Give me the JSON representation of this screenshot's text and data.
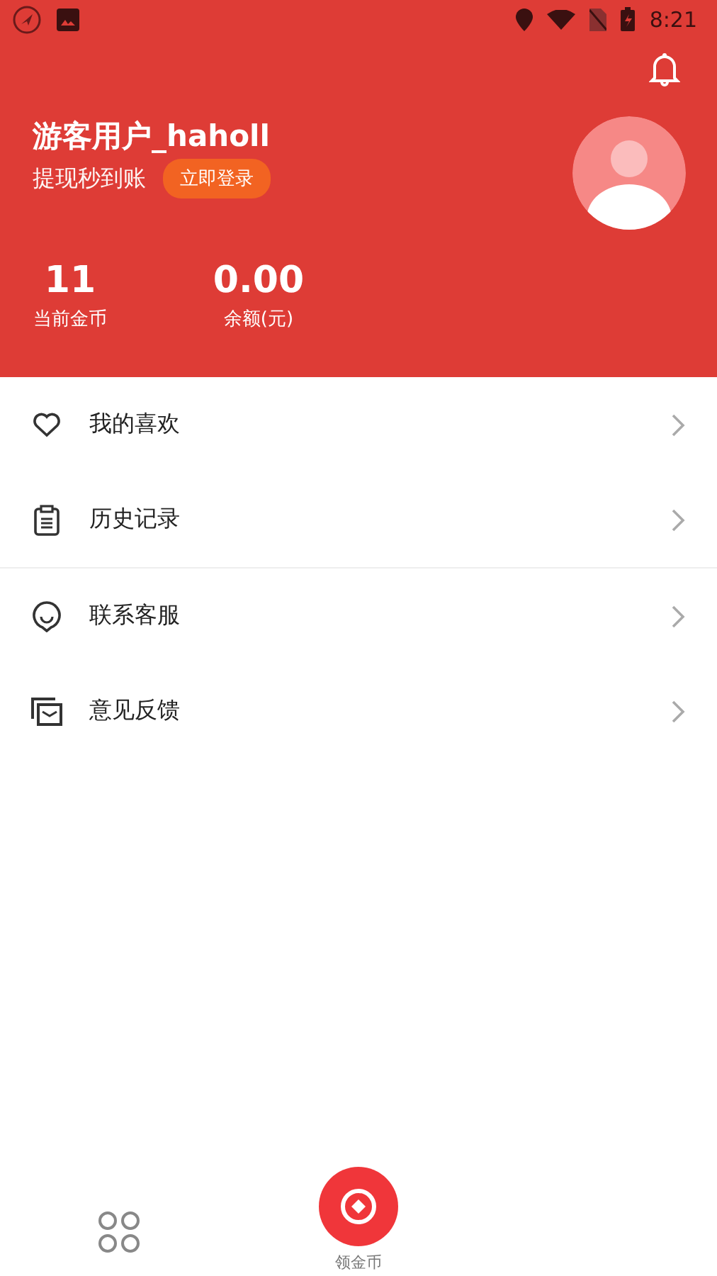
{
  "status_bar": {
    "time": "8:21"
  },
  "profile": {
    "name": "游客用户_haholl",
    "subtitle": "提现秒到账",
    "login_button": "立即登录",
    "stats": [
      {
        "value": "11",
        "label": "当前金币"
      },
      {
        "value": "0.00",
        "label": "余额(元)"
      }
    ]
  },
  "menu_groups": [
    [
      {
        "label": "我的喜欢"
      },
      {
        "label": "历史记录"
      }
    ],
    [
      {
        "label": "联系客服"
      },
      {
        "label": "意见反馈"
      }
    ]
  ],
  "bottom_nav": {
    "center_label": "领金币"
  }
}
